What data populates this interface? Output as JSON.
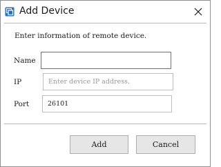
{
  "window": {
    "title": "Add Device",
    "icon": "device-app-icon",
    "close_icon": "close-icon"
  },
  "form": {
    "description": "Enter information of remote device.",
    "name": {
      "label": "Name",
      "value": "",
      "placeholder": ""
    },
    "ip": {
      "label": "IP",
      "value": "",
      "placeholder": "Enter device IP address."
    },
    "port": {
      "label": "Port",
      "value": "26101",
      "placeholder": ""
    }
  },
  "buttons": {
    "add_label": "Add",
    "cancel_label": "Cancel"
  },
  "colors": {
    "accent": "#2f7ed8",
    "icon_blue": "#1e6fd0",
    "button_face": "#e6e6e6"
  }
}
